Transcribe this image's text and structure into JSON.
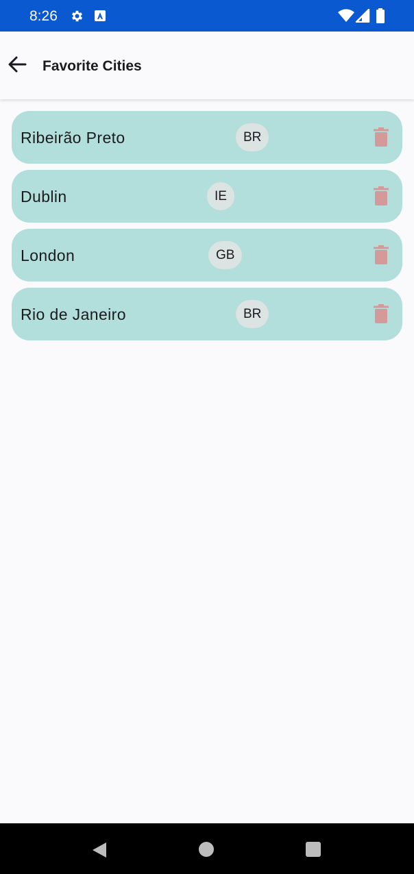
{
  "status_bar": {
    "time": "8:26",
    "icons": [
      "gear-icon",
      "accessibility-a-icon",
      "wifi-icon",
      "cell-signal-icon",
      "battery-icon"
    ],
    "background_color": "#0a59d0"
  },
  "app_bar": {
    "title": "Favorite Cities",
    "back_icon": "arrow-back-icon"
  },
  "cities": [
    {
      "name": "Ribeirão Preto",
      "country": "BR",
      "delete_icon": "trash-icon"
    },
    {
      "name": "Dublin",
      "country": "IE",
      "delete_icon": "trash-icon"
    },
    {
      "name": "London",
      "country": "GB",
      "delete_icon": "trash-icon"
    },
    {
      "name": "Rio de Janeiro",
      "country": "BR",
      "delete_icon": "trash-icon"
    }
  ],
  "colors": {
    "card_background": "#b2dfdb",
    "chip_background": "#dbe3e3",
    "delete_icon": "#d49a9a",
    "page_background": "#fafafd"
  },
  "nav_bar": {
    "icons": [
      "nav-back-icon",
      "nav-home-icon",
      "nav-recents-icon"
    ]
  }
}
